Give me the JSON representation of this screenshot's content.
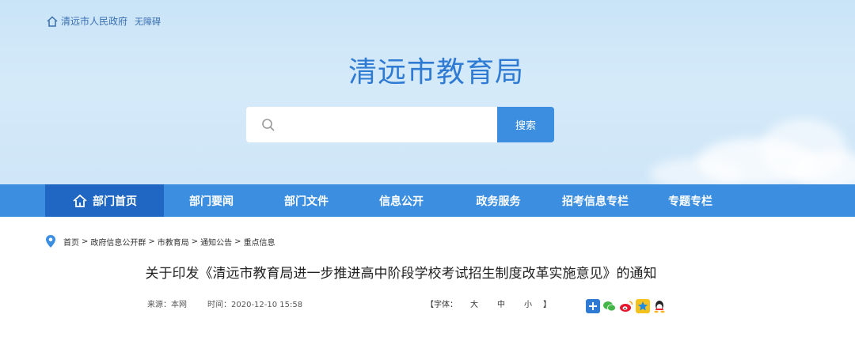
{
  "top_links": {
    "gov_portal": "清远市人民政府",
    "accessibility": "无障碍"
  },
  "site": {
    "title": "清远市教育局"
  },
  "search": {
    "placeholder": "",
    "button_label": "搜索"
  },
  "nav": {
    "items": [
      {
        "label": "部门首页",
        "active": true
      },
      {
        "label": "部门要闻"
      },
      {
        "label": "部门文件"
      },
      {
        "label": "信息公开"
      },
      {
        "label": "政务服务"
      },
      {
        "label": "招考信息专栏"
      },
      {
        "label": "专题专栏"
      }
    ]
  },
  "breadcrumb": {
    "items": [
      "首页",
      "政府信息公开群",
      "市教育局",
      "通知公告",
      "重点信息"
    ],
    "separator": ">"
  },
  "article": {
    "title": "关于印发《清远市教育局进一步推进高中阶段学校考试招生制度改革实施意见》的通知",
    "source": "来源：本网",
    "time": "时间：2020-12-10 15:58"
  },
  "font_size": {
    "open": "【字体：",
    "large": "大",
    "medium": "中",
    "small": "小",
    "close": "】"
  },
  "share_icons": [
    "plus-share-icon",
    "wechat-icon",
    "weibo-icon",
    "qzone-icon",
    "qq-icon"
  ],
  "colors": {
    "nav": "#3c8fe0",
    "nav_active": "#1f67c2",
    "title_blue": "#2f7bd4"
  }
}
